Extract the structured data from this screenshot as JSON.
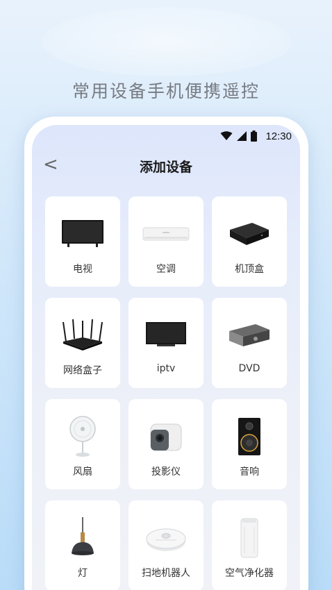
{
  "tagline": "常用设备手机便携遥控",
  "status": {
    "time": "12:30",
    "icons": [
      "wifi-icon",
      "signal-icon",
      "battery-icon"
    ]
  },
  "header": {
    "back_label": "<",
    "title": "添加设备"
  },
  "devices": [
    {
      "label": "电视",
      "icon": "tv-icon"
    },
    {
      "label": "空调",
      "icon": "air-conditioner-icon"
    },
    {
      "label": "机顶盒",
      "icon": "set-top-box-icon"
    },
    {
      "label": "网络盒子",
      "icon": "router-icon"
    },
    {
      "label": "iptv",
      "icon": "iptv-icon"
    },
    {
      "label": "DVD",
      "icon": "dvd-player-icon"
    },
    {
      "label": "风扇",
      "icon": "fan-icon"
    },
    {
      "label": "投影仪",
      "icon": "projector-icon"
    },
    {
      "label": "音响",
      "icon": "speaker-icon"
    },
    {
      "label": "灯",
      "icon": "lamp-icon"
    },
    {
      "label": "扫地机器人",
      "icon": "robot-vacuum-icon"
    },
    {
      "label": "空气净化器",
      "icon": "air-purifier-icon"
    }
  ]
}
